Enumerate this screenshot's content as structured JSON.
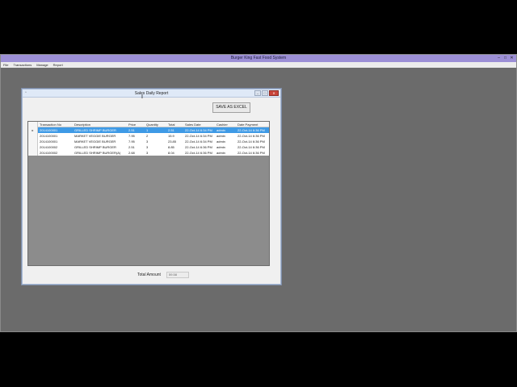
{
  "main_window": {
    "title": "Burger King Fast Food System",
    "controls": {
      "minimize": "–",
      "maximize": "□",
      "close": "✕"
    },
    "menu": [
      "File",
      "Transactions",
      "Manage",
      "Report"
    ]
  },
  "dialog": {
    "title": "Sales Daily Report",
    "controls": {
      "minimize": "–",
      "maximize": "□",
      "close": "✕"
    },
    "save_button_label": "SAVE AS EXCEL",
    "total_label": "Total Amount",
    "total_value": "59.58"
  },
  "grid": {
    "columns": [
      "Transaction No",
      "Description",
      "Price",
      "Quantity",
      "Total",
      "Sales Date",
      "Cashier",
      "Date Payment"
    ],
    "rows": [
      {
        "selected": true,
        "indicator": "▸",
        "cells": [
          "2014100001",
          "GRILLED SHRIMP BURGER",
          "2.51",
          "1",
          "2.51",
          "22-Oct-14 6:34 PM",
          "admin",
          "22-Oct-14 6:36 PM"
        ]
      },
      {
        "selected": false,
        "indicator": "",
        "cells": [
          "2014100001",
          "MARKET VEGGIE BURGER",
          "7.95",
          "2",
          "15.9",
          "22-Oct-14 6:34 PM",
          "admin",
          "22-Oct-14 6:36 PM"
        ]
      },
      {
        "selected": false,
        "indicator": "",
        "cells": [
          "2014100001",
          "MARKET VEGGIE BURGER",
          "7.95",
          "3",
          "23.85",
          "22-Oct-14 6:34 PM",
          "admin",
          "22-Oct-14 6:36 PM"
        ]
      },
      {
        "selected": false,
        "indicator": "",
        "cells": [
          "2014100002",
          "GRILLED SHRIMP BURGER",
          "2.51",
          "3",
          "8.85",
          "22-Oct-14 6:36 PM",
          "admin",
          "22-Oct-14 6:36 PM"
        ]
      },
      {
        "selected": false,
        "indicator": "",
        "cells": [
          "2014100002",
          "GRILLED SHRIMP BURGER(A)",
          "2.68",
          "3",
          "8.04",
          "22-Oct-14 6:36 PM",
          "admin",
          "22-Oct-14 6:36 PM"
        ]
      }
    ]
  },
  "colors": {
    "selection": "#3e9ae6",
    "main_titlebar": "#9c8fd6",
    "mdi_background": "#6b6b6b"
  }
}
